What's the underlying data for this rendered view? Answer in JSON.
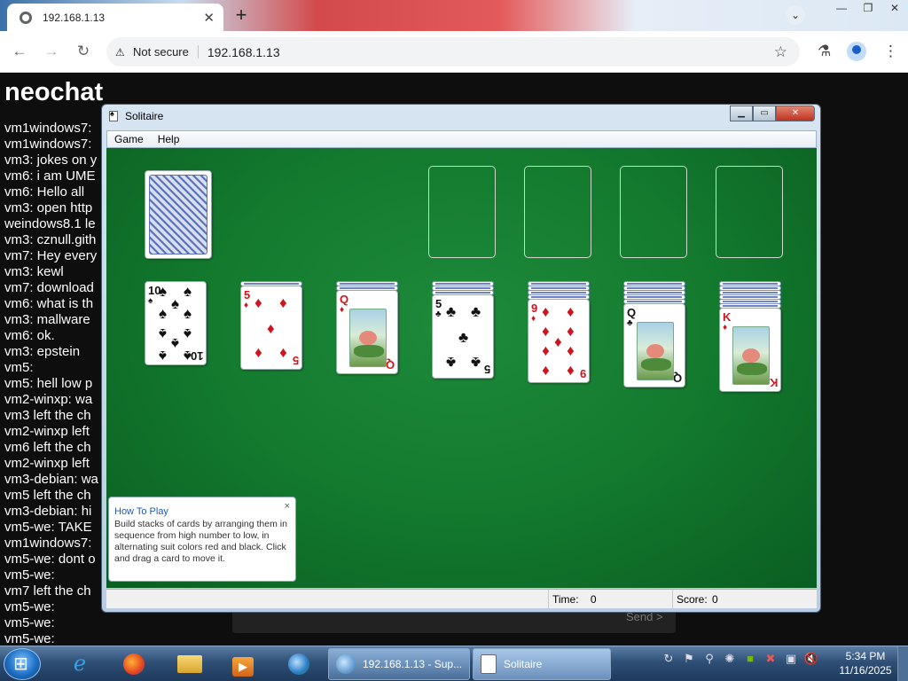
{
  "browser": {
    "tab_title": "192.168.1.13",
    "tab_close": "✕",
    "new_tab": "+",
    "tab_dropdown": "⌄",
    "window_controls": [
      "—",
      "❐",
      "✕"
    ],
    "nav": {
      "back": "←",
      "forward": "→",
      "reload": "↻"
    },
    "security_label": "Not secure",
    "url": "192.168.1.13",
    "icons": {
      "star": "☆",
      "labs": "⚗",
      "menu": "⋮"
    }
  },
  "chat": {
    "title": "neochat",
    "messages": [
      "vm1windows7:",
      "vm1windows7:",
      "vm3: jokes on y",
      "vm6: i am UME",
      "vm6: Hello all",
      "vm3: open http",
      "weindows8.1 le",
      "vm3: cznull.gith",
      "vm7: Hey every",
      "vm3: kewl",
      "vm7: download",
      "vm6: what is th",
      "vm3: mallware",
      "vm6: ok.",
      "vm3: epstein",
      "vm5:",
      "vm5: hell low p",
      "vm2-winxp: wa",
      "vm3 left the ch",
      "vm2-winxp left",
      "vm6 left the ch",
      "vm2-winxp left",
      "vm3-debian: wa",
      "vm5 left the ch",
      "vm3-debian: hi",
      "vm5-we: TAKE",
      "vm1windows7:",
      "vm5-we: dont o",
      "vm5-we:",
      "vm7 left the ch",
      "vm5-we:",
      "vm5-we:",
      "vm5-we:"
    ],
    "send_label": "Send >"
  },
  "solitaire": {
    "window_title": "Solitaire",
    "controls": {
      "minimize": "▁",
      "maximize": "▭",
      "close": "✕"
    },
    "menu": [
      "Game",
      "Help"
    ],
    "tableau": [
      {
        "hidden": 0,
        "rank": "10",
        "suit": "♠",
        "color": "black"
      },
      {
        "hidden": 1,
        "rank": "5",
        "suit": "♦",
        "color": "red"
      },
      {
        "hidden": 2,
        "rank": "Q",
        "suit": "♦",
        "color": "red"
      },
      {
        "hidden": 3,
        "rank": "5",
        "suit": "♣",
        "color": "black"
      },
      {
        "hidden": 4,
        "rank": "9",
        "suit": "♦",
        "color": "red"
      },
      {
        "hidden": 5,
        "rank": "Q",
        "suit": "♣",
        "color": "black"
      },
      {
        "hidden": 6,
        "rank": "K",
        "suit": "♦",
        "color": "red"
      }
    ],
    "how_to_play": {
      "heading": "How To Play",
      "body": "Build stacks of cards by arranging them in sequence from high number to low, in alternating suit colors red and black. Click and drag a card to move it.",
      "close": "×"
    },
    "status": {
      "time_label": "Time:",
      "time_value": "0",
      "score_label": "Score:",
      "score_value": "0"
    }
  },
  "taskbar": {
    "tasks": [
      {
        "label": "192.168.1.13 - Sup..."
      },
      {
        "label": "Solitaire"
      }
    ],
    "clock_time": "5:34 PM",
    "clock_date": "11/16/2025"
  }
}
